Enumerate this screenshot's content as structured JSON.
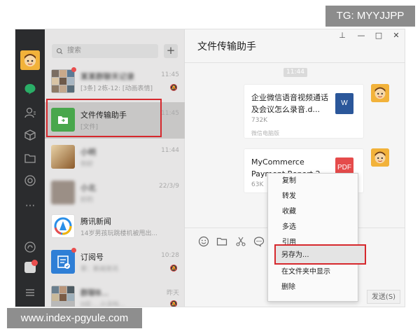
{
  "watermarks": {
    "top": "TG: MYYJJPP",
    "bottom": "www.index-pgyule.com"
  },
  "search": {
    "placeholder": "搜索",
    "add_label": "+"
  },
  "chat_list": [
    {
      "title": "某某群聊天记录",
      "subtitle": "[3条] 2栋-12: [动画表情]",
      "time": "11:45",
      "muted": true,
      "unread_dot": true,
      "blurred": true
    },
    {
      "title": "文件传输助手",
      "subtitle": "[文件]",
      "time": "11:45",
      "muted": false,
      "unread_dot": false,
      "blurred": false,
      "selected": true
    },
    {
      "title": "小明",
      "subtitle": "你好",
      "time": "11:44",
      "muted": false,
      "unread_dot": false,
      "blurred": true
    },
    {
      "title": "小北",
      "subtitle": "好的",
      "time": "22/3/9",
      "muted": false,
      "unread_dot": false,
      "blurred": true
    },
    {
      "title": "腾讯新闻",
      "subtitle": "14岁男孩玩跳楼机被甩出...",
      "time": "",
      "muted": false,
      "unread_dot": false,
      "blurred": false
    },
    {
      "title": "订阅号",
      "subtitle": "草：新闻资讯",
      "time": "10:28",
      "muted": true,
      "unread_dot": true,
      "blurred": false
    },
    {
      "title": "群聊B...",
      "subtitle": "D区-...小沃吗...",
      "time": "昨天",
      "muted": true,
      "unread_dot": false,
      "blurred": true
    }
  ],
  "chat": {
    "title": "文件传输助手",
    "time_chip": "11:44",
    "messages": [
      {
        "file_name": "企业微信语音视频通话及会议怎么录音.d...",
        "size": "732K",
        "source": "微信电脑版",
        "icon": "W"
      },
      {
        "file_name": "MyCommerce Payment Report 2...",
        "size": "63K",
        "source": "",
        "icon": "PDF"
      }
    ],
    "send_label": "发送(S)"
  },
  "window_controls": {
    "pin": "⊥",
    "minimize": "—",
    "maximize": "□",
    "close": "✕"
  },
  "context_menu": {
    "items": [
      "复制",
      "转发",
      "收藏",
      "多选",
      "引用",
      "另存为...",
      "在文件夹中显示",
      "删除"
    ]
  },
  "colors": {
    "accent": "#2aae67",
    "highlight_border": "#d6282d",
    "rail": "#2b2c2e"
  }
}
